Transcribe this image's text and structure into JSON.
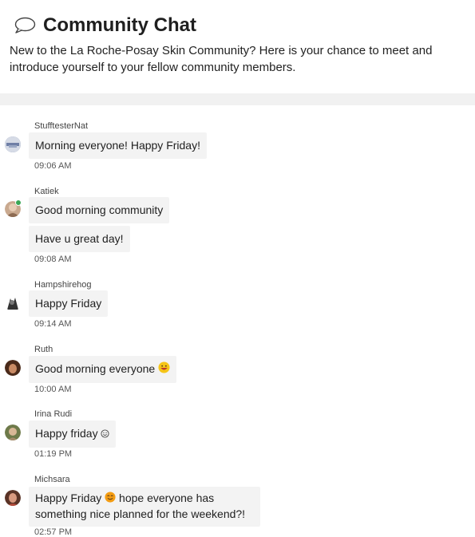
{
  "page": {
    "title": "Community Chat",
    "description": "New to the La Roche-Posay Skin Community? Here is your chance to meet and introduce yourself to your fellow community members."
  },
  "colors": {
    "bubble": "#f3f3f3",
    "divider": "#f1f1f1",
    "online": "#3aa655"
  },
  "messages": [
    {
      "user": "StufftesterNat",
      "avatar_icon": "user-avatar-icon",
      "texts": [
        "Morning everyone! Happy Friday!"
      ],
      "time": "09:06 AM"
    },
    {
      "user": "Katiek",
      "avatar_icon": "user-avatar-icon",
      "online": true,
      "texts": [
        "Good morning community",
        "Have u great day!"
      ],
      "time": "09:08 AM"
    },
    {
      "user": "Hampshirehog",
      "avatar_icon": "user-avatar-icon",
      "texts": [
        "Happy Friday"
      ],
      "time": "09:14 AM"
    },
    {
      "user": "Ruth",
      "avatar_icon": "user-avatar-icon",
      "texts": [
        "Good morning everyone"
      ],
      "emoji": "grinning-face-emoji",
      "time": "10:00 AM"
    },
    {
      "user": "Irina Rudi",
      "avatar_icon": "user-avatar-icon",
      "texts": [
        "Happy friday"
      ],
      "emoji": "smiley-emoji",
      "time": "01:19 PM"
    },
    {
      "user": "Michsara",
      "avatar_icon": "user-avatar-icon",
      "texts": [
        "Happy Friday",
        "hope everyone has something nice planned for the weekend?!"
      ],
      "emoji": "smiling-face-emoji",
      "time": "02:57 PM"
    }
  ]
}
